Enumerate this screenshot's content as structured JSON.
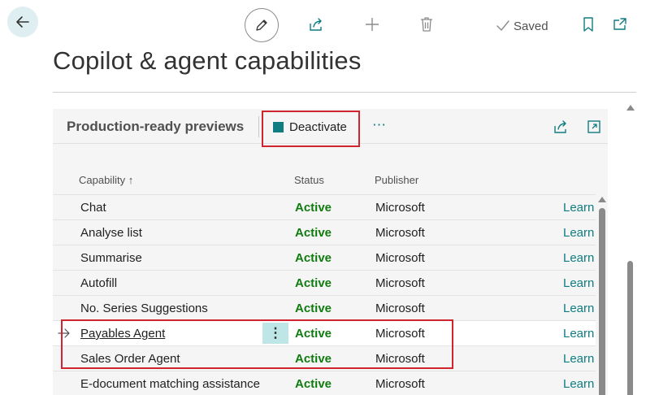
{
  "toolbar": {
    "back_icon": "arrow-left-icon",
    "edit_icon": "pencil-icon",
    "share_icon": "share-icon",
    "new_icon": "plus-icon",
    "delete_icon": "trash-icon",
    "saved_label": "Saved",
    "bookmark_icon": "bookmark-icon",
    "open_new_window_icon": "open-in-new-window-icon"
  },
  "page": {
    "title": "Copilot & agent capabilities"
  },
  "part": {
    "title": "Production-ready previews",
    "deactivate_label": "Deactivate",
    "more_label": "⋯",
    "columns": {
      "capability": "Capability ↑",
      "status": "Status",
      "publisher": "Publisher"
    },
    "rows": [
      {
        "capability": "Chat",
        "status": "Active",
        "publisher": "Microsoft",
        "learn": "Learn"
      },
      {
        "capability": "Analyse list",
        "status": "Active",
        "publisher": "Microsoft",
        "learn": "Learn"
      },
      {
        "capability": "Summarise",
        "status": "Active",
        "publisher": "Microsoft",
        "learn": "Learn"
      },
      {
        "capability": "Autofill",
        "status": "Active",
        "publisher": "Microsoft",
        "learn": "Learn"
      },
      {
        "capability": "No. Series Suggestions",
        "status": "Active",
        "publisher": "Microsoft",
        "learn": "Learn"
      },
      {
        "capability": "Payables Agent",
        "status": "Active",
        "publisher": "Microsoft",
        "learn": "Learn",
        "selected": true
      },
      {
        "capability": "Sales Order Agent",
        "status": "Active",
        "publisher": "Microsoft",
        "learn": "Learn"
      },
      {
        "capability": "E-document matching assistance",
        "status": "Active",
        "publisher": "Microsoft",
        "learn": "Learn"
      }
    ]
  },
  "colors": {
    "accent": "#0f7c80",
    "status_active": "#107c10",
    "highlight": "#d0252e"
  }
}
